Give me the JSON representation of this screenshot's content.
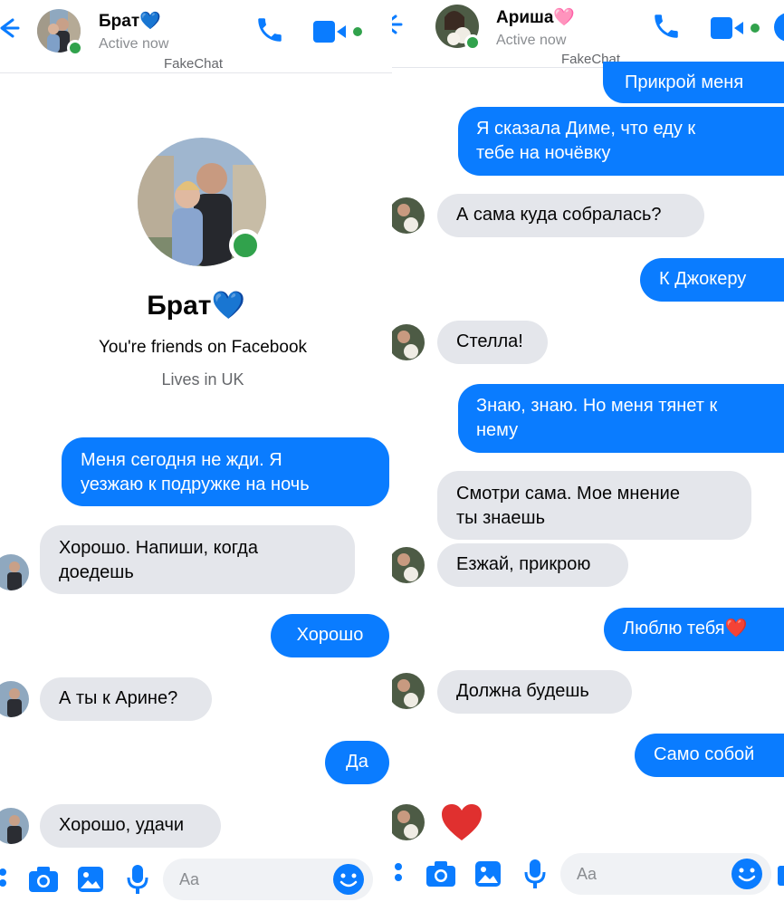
{
  "left": {
    "header": {
      "name": "Брат",
      "name_emoji": "💙",
      "status": "Active now",
      "watermark": "FakeChat"
    },
    "profile": {
      "name": "Брат",
      "name_emoji": "💙",
      "friends_text": "You're friends on Facebook",
      "lives_text": "Lives in UK"
    },
    "messages": [
      {
        "dir": "out",
        "text": "Меня сегодня не жди. Я\nуезжаю к подружке на ночь"
      },
      {
        "dir": "in",
        "text": "Хорошо. Напиши, когда\nдоедешь"
      },
      {
        "dir": "out",
        "text": "Хорошо"
      },
      {
        "dir": "in",
        "text": "А ты к Арине?"
      },
      {
        "dir": "out",
        "text": "Да"
      },
      {
        "dir": "in",
        "text": "Хорошо, удачи"
      }
    ],
    "composer": {
      "placeholder": "Aa"
    }
  },
  "right": {
    "header": {
      "name": "Ариша",
      "name_emoji": "🩷",
      "status": "Active now",
      "watermark": "FakeChat"
    },
    "messages": [
      {
        "dir": "out",
        "text": "Прикрой меня"
      },
      {
        "dir": "out",
        "text": "Я сказала Диме, что еду к\nтебе на ночёвку"
      },
      {
        "dir": "in",
        "text": "А сама куда собралась?"
      },
      {
        "dir": "out",
        "text": "К Джокеру"
      },
      {
        "dir": "in",
        "text": "Стелла!"
      },
      {
        "dir": "out",
        "text": "Знаю, знаю. Но меня тянет к\nнему"
      },
      {
        "dir": "in",
        "text": "Смотри сама. Мое мнение\nты знаешь"
      },
      {
        "dir": "in",
        "text": "Езжай, прикрою"
      },
      {
        "dir": "out",
        "text": "Люблю тебя"
      },
      {
        "dir": "in",
        "text": "Должна будешь"
      },
      {
        "dir": "out",
        "text": "Само собой"
      }
    ],
    "composer": {
      "placeholder": "Aa"
    }
  },
  "colors": {
    "accent": "#0a7cff",
    "incoming": "#e4e6eb",
    "online": "#31a24c"
  }
}
